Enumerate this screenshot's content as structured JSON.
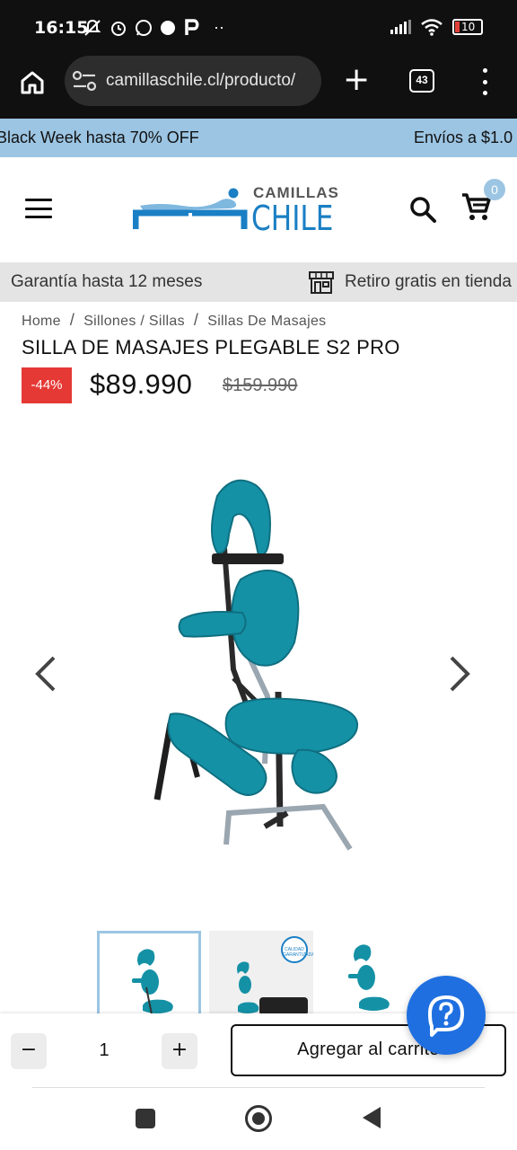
{
  "status_bar": {
    "time": "16:15",
    "battery": "10",
    "extra": "··"
  },
  "browser": {
    "url": "camillaschile.cl/producto/",
    "tab_count": "43"
  },
  "promo": {
    "text_1": "Black Week hasta 70% OFF",
    "text_2": "Envíos a $1.0"
  },
  "header": {
    "logo_line_1": "CAMILLAS",
    "logo_line_2": "CHILE",
    "cart_count": "0"
  },
  "info_bar": {
    "text_1": "Garantía hasta 12 meses",
    "text_2": "Retiro gratis en tienda"
  },
  "breadcrumb": {
    "items": [
      "Home",
      "Sillones / Sillas",
      "Sillas De Masajes"
    ],
    "separator": "/"
  },
  "product": {
    "title": "SILLA DE MASAJES PLEGABLE S2 PRO",
    "discount": "-44%",
    "price": "$89.990",
    "old_price": "$159.990"
  },
  "gallery": {
    "seal_text": "CALIDAD GARANTIZADA"
  },
  "cart_bar": {
    "minus": "−",
    "quantity": "1",
    "plus": "+",
    "add_label": "Agregar al carrito"
  },
  "colors": {
    "brand_blue": "#1a7fc4",
    "light_blue": "#9cc5e3",
    "chair_teal": "#1591a6",
    "discount_red": "#e53935",
    "fab_blue": "#1f6fe0"
  }
}
